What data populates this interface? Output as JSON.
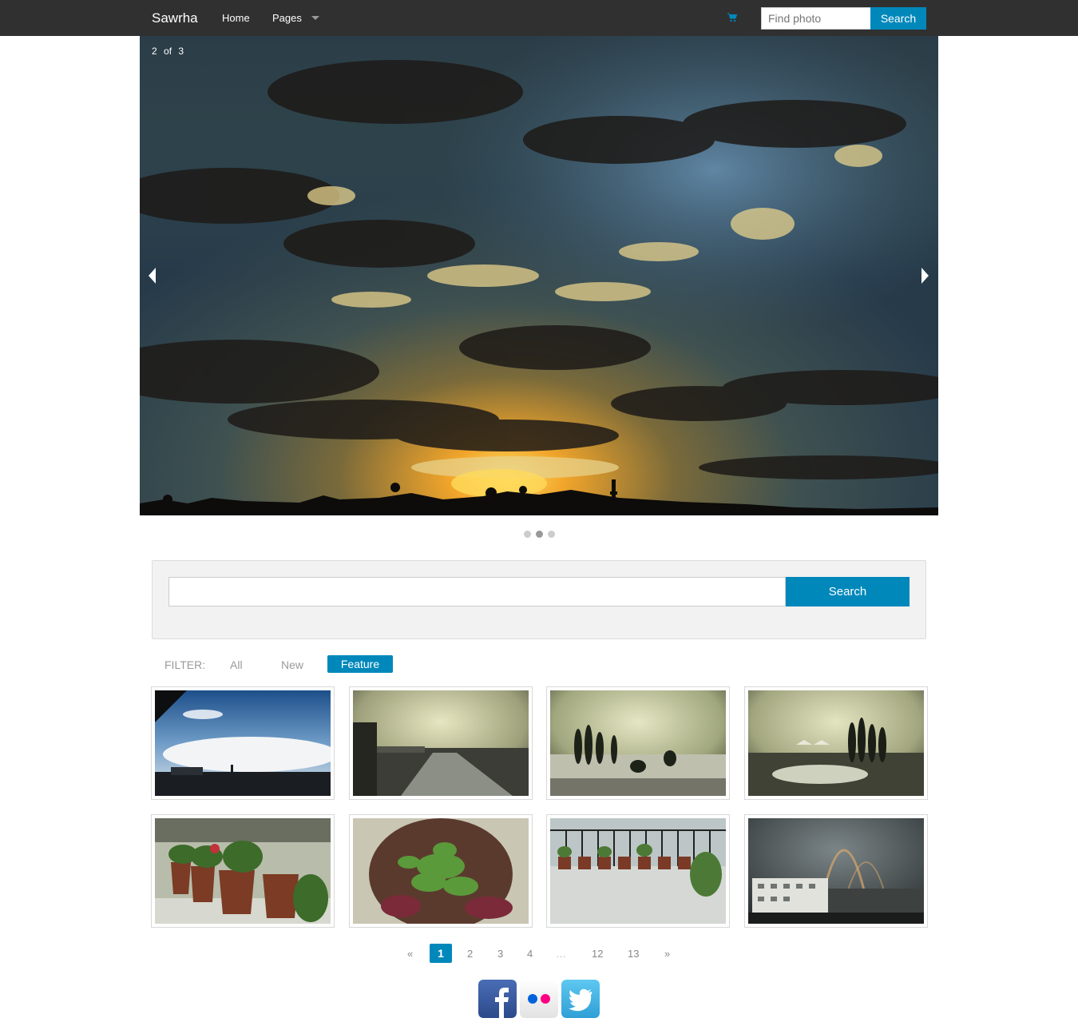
{
  "navbar": {
    "brand": "Sawrha",
    "items": [
      {
        "label": "Home"
      },
      {
        "label": "Pages"
      }
    ],
    "cart_icon": "cart-icon",
    "search_placeholder": "Find photo",
    "search_button": "Search"
  },
  "carousel": {
    "current": "2",
    "of_label": "of",
    "total": "3",
    "active_slide": 2,
    "slide_count": 3
  },
  "search_panel": {
    "input_value": "",
    "button": "Search"
  },
  "filter": {
    "label": "FILTER:",
    "options": [
      "All",
      "New",
      "Feature"
    ],
    "active": "Feature"
  },
  "pagination": {
    "prev": "«",
    "pages": [
      "1",
      "2",
      "3",
      "4",
      "…",
      "12",
      "13"
    ],
    "next": "»",
    "active": "1"
  },
  "social": [
    "facebook-icon",
    "flickr-icon",
    "twitter-icon"
  ],
  "colors": {
    "navbar_bg": "#303030",
    "accent": "#0088bb",
    "panel_bg": "#f2f2f2"
  }
}
